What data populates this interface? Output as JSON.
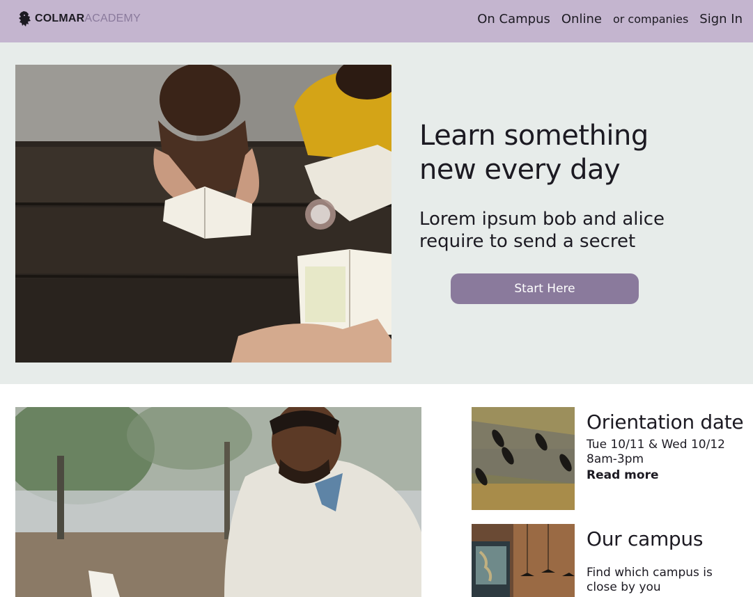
{
  "header": {
    "logo_word_1": "COLMAR",
    "logo_word_2": "ACADEMY",
    "nav": [
      {
        "label": "On Campus"
      },
      {
        "label": "Online"
      },
      {
        "label": "or companies"
      },
      {
        "label": "Sign In"
      }
    ]
  },
  "hero": {
    "title": "Learn something new every day",
    "subtitle": "Lorem ipsum bob and alice require to send a secret",
    "cta_label": "Start Here"
  },
  "cards": [
    {
      "title": "Orientation date",
      "lines": [
        "Tue 10/11 & Wed 10/12",
        "8am-3pm"
      ],
      "link": "Read more"
    },
    {
      "title": "Our campus",
      "lines": [
        "Find which campus is close by you"
      ]
    }
  ],
  "colors": {
    "header_bg": "#c4b5cf",
    "hero_bg": "#e7ecea",
    "accent": "#8a7a9c",
    "text": "#1c1a22"
  }
}
